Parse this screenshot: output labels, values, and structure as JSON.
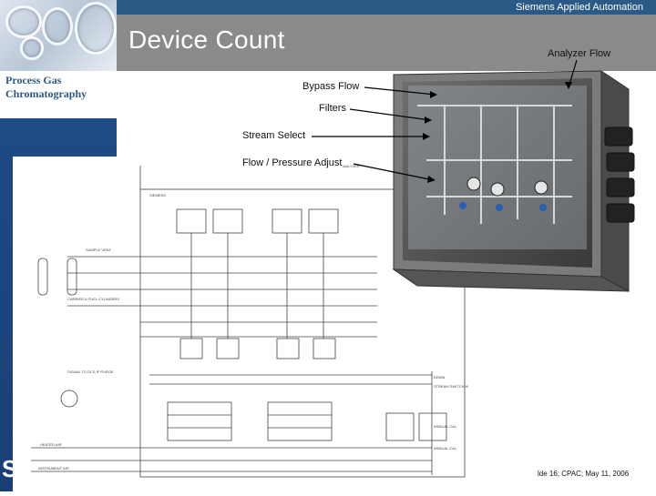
{
  "header": {
    "company": "Siemens Applied Automation",
    "title": "Device Count"
  },
  "sidebar": {
    "label_line1": "Process Gas",
    "label_line2": "Chromatography"
  },
  "callouts": {
    "analyzer_flow": "Analyzer Flow",
    "bypass_flow": "Bypass Flow",
    "filters": "Filters",
    "stream_select": "Stream Select",
    "flow_pressure_adjust": "Flow / Pressure Adjust"
  },
  "footer": {
    "slide_info": "lde 16;  CPAC; May 11, 2006"
  },
  "colors": {
    "top_bar": "#2c5a86",
    "header_gray": "#8a8a8a",
    "sidebar_blue": "#1f4c88"
  }
}
